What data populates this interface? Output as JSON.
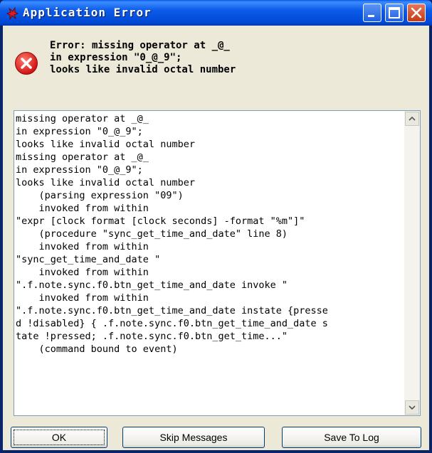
{
  "window": {
    "title": "Application Error",
    "app_icon": "tk-feather-icon"
  },
  "title_buttons": {
    "minimize_icon": "minimize-icon",
    "maximize_icon": "maximize-icon",
    "close_icon": "close-icon"
  },
  "error": {
    "icon": "error-icon",
    "color": "#E21A1A",
    "message": "Error: missing operator at _@_\nin expression \"0_@_9\";\nlooks like invalid octal number"
  },
  "details": {
    "text": "missing operator at _@_\nin expression \"0_@_9\";\nlooks like invalid octal number\nmissing operator at _@_\nin expression \"0_@_9\";\nlooks like invalid octal number\n    (parsing expression \"09\")\n    invoked from within\n\"expr [clock format [clock seconds] -format \"%m\"]\"\n    (procedure \"sync_get_time_and_date\" line 8)\n    invoked from within\n\"sync_get_time_and_date \"\n    invoked from within\n\".f.note.sync.f0.btn_get_time_and_date invoke \"\n    invoked from within\n\".f.note.sync.f0.btn_get_time_and_date instate {presse\nd !disabled} { .f.note.sync.f0.btn_get_time_and_date s\ntate !pressed; .f.note.sync.f0.btn_get_time...\"\n    (command bound to event)"
  },
  "buttons": {
    "ok": "OK",
    "skip": "Skip Messages",
    "log": "Save To Log"
  }
}
